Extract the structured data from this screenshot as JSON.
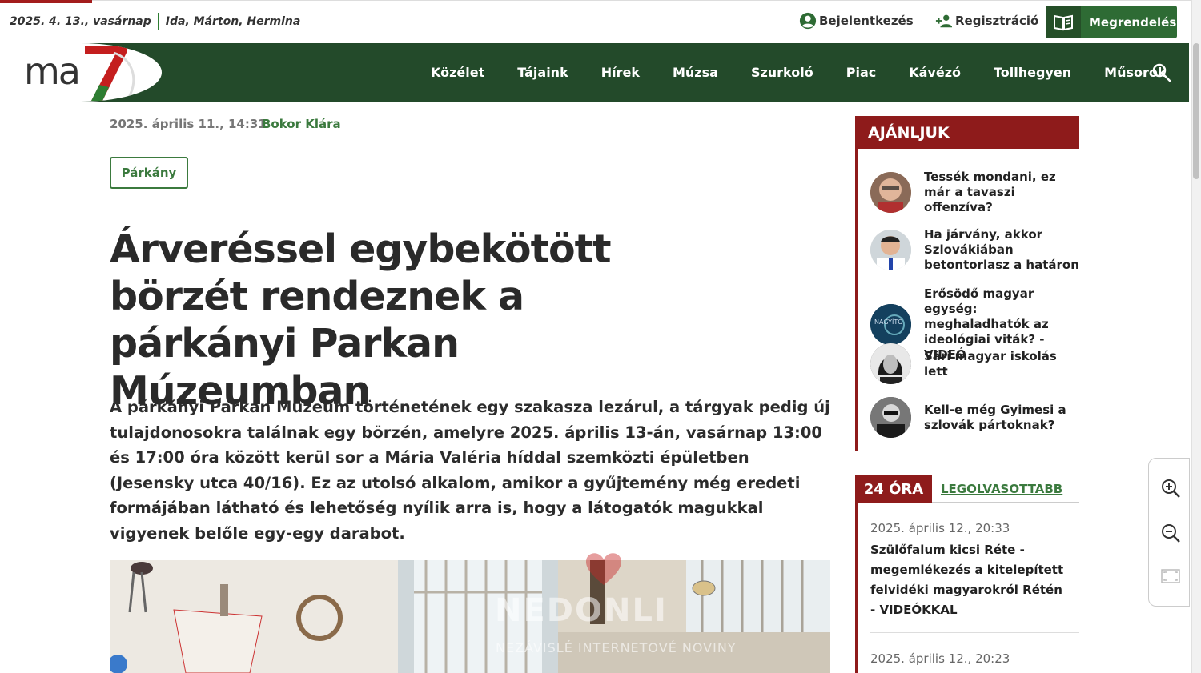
{
  "topbar": {
    "date": "2025. 4. 13., vasárnap",
    "namedays": "Ida, Márton, Hermina",
    "login": "Bejelentkezés",
    "register": "Regisztráció",
    "order": "Megrendelés"
  },
  "logo": {
    "text": "ma",
    "digit": "7"
  },
  "nav": {
    "items": [
      "Közélet",
      "Tájaink",
      "Hírek",
      "Múzsa",
      "Szurkoló",
      "Piac",
      "Kávézó",
      "Tollhegyen",
      "Műsorok"
    ]
  },
  "article": {
    "date": "2025. április 11., 14:31",
    "author": "Bokor Klára",
    "tag": "Párkány",
    "headline": "Árveréssel egybekötött börzét rendeznek a párkányi Parkan Múzeumban",
    "lead": "A párkányi Parkan Múzeum történetének egy szakasza lezárul, a tárgyak pedig új tulajdonosokra találnak egy börzén, amelyre 2025. április 13-án, vasárnap 13:00 és 17:00 óra között kerül sor a Mária Valéria híddal szemközti épületben (Jesensky utca 40/16). Ez az utolsó alkalom, amikor a gyűjtemény még eredeti formájában látható és lehetőség nyílik arra is, hogy a látogatók magukkal vigyenek belőle egy-egy darabot.",
    "watermark": "NEDONLI",
    "watermark_sub": "NEZÁVISLÉ INTERNETOVÉ NOVINY"
  },
  "sidebar": {
    "recommend_title": "AJÁNLJUK",
    "recommend": [
      "Tessék mondani, ez már a tavaszi offenzíva?",
      "Ha járvány, akkor Szlovákiában betontorlasz a határon",
      "Erősödő magyar egység: meghaladhatók az ideológiai viták? - VIDEÓ",
      "Sári magyar iskolás lett",
      "Kell-e még Gyimesi a szlovák pártoknak?"
    ],
    "recommend_avatar_text": "NAGYÍTÓ",
    "h24": "24 ÓRA",
    "mostread": "LEGOLVASOTTABB",
    "news": [
      {
        "date": "2025. április 12., 20:33",
        "title": "Szülőfalum kicsi Réte - megemlékezés a kitelepített felvidéki magyarokról Rétén - VIDEÓKKAL"
      },
      {
        "date": "2025. április 12., 20:23",
        "title": ""
      }
    ]
  }
}
